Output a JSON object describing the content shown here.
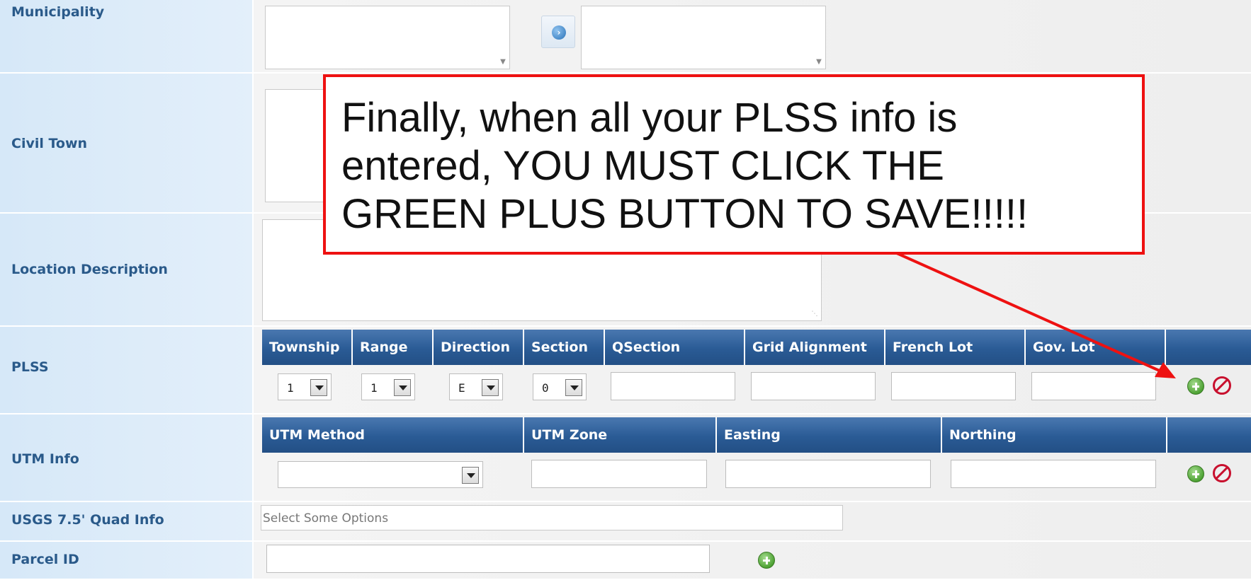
{
  "rows": {
    "municipality": {
      "label": "Municipality"
    },
    "civil_town": {
      "label": "Civil Town"
    },
    "location_description": {
      "label": "Location Description"
    },
    "plss": {
      "label": "PLSS",
      "columns": [
        "Township",
        "Range",
        "Direction",
        "Section",
        "QSection",
        "Grid Alignment",
        "French Lot",
        "Gov. Lot"
      ],
      "township_value": "1",
      "range_value": "1",
      "direction_value": "E",
      "section_value": "0",
      "qsection_value": "",
      "grid_alignment_value": "",
      "french_lot_value": "",
      "gov_lot_value": ""
    },
    "utm_info": {
      "label": "UTM Info",
      "columns": [
        "UTM Method",
        "UTM Zone",
        "Easting",
        "Northing"
      ],
      "utm_method_value": "",
      "utm_zone_value": "",
      "easting_value": "",
      "northing_value": ""
    },
    "usgs_quad": {
      "label": "USGS 7.5' Quad Info",
      "placeholder": "Select Some Options"
    },
    "parcel_id": {
      "label": "Parcel ID",
      "value": ""
    }
  },
  "callout": {
    "lines": [
      "Finally, when all your PLSS info is",
      "entered, YOU MUST CLICK THE",
      "GREEN PLUS BUTTON TO SAVE!!!!!"
    ],
    "border_color": "#ee1111"
  },
  "colors": {
    "label_text": "#2a5a8a",
    "grid_header": "#2a5b95",
    "add_button": "#4ea234",
    "remove_button": "#c8102e"
  },
  "icons": {
    "info": "info-icon",
    "add": "green-plus-icon",
    "remove": "red-cancel-icon"
  }
}
